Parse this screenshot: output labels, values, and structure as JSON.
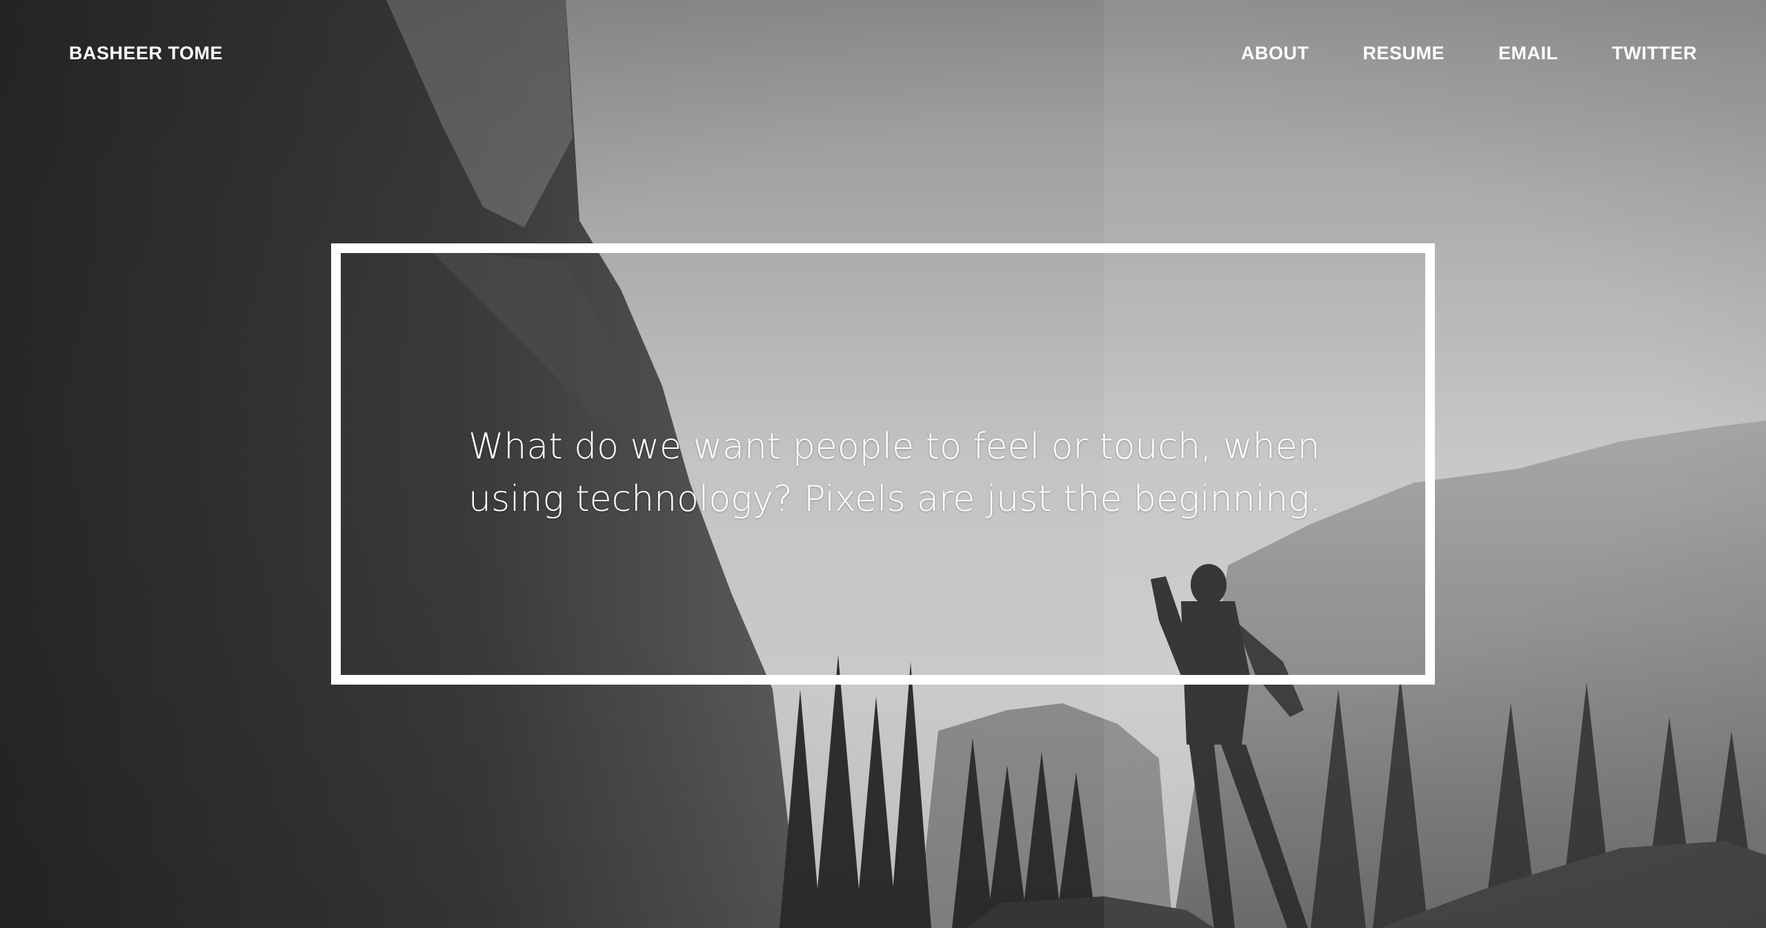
{
  "header": {
    "brand": "BASHEER TOME",
    "nav": [
      {
        "label": "ABOUT"
      },
      {
        "label": "RESUME"
      },
      {
        "label": "EMAIL"
      },
      {
        "label": "TWITTER"
      }
    ]
  },
  "hero": {
    "tagline": "What do we want people to feel or touch, when using technology? Pixels are just the beginning.",
    "background": "grayscale photo: hiker photographing mountains between cliff and pine trees"
  },
  "colors": {
    "text": "#ffffff",
    "frame": "#ffffff"
  }
}
